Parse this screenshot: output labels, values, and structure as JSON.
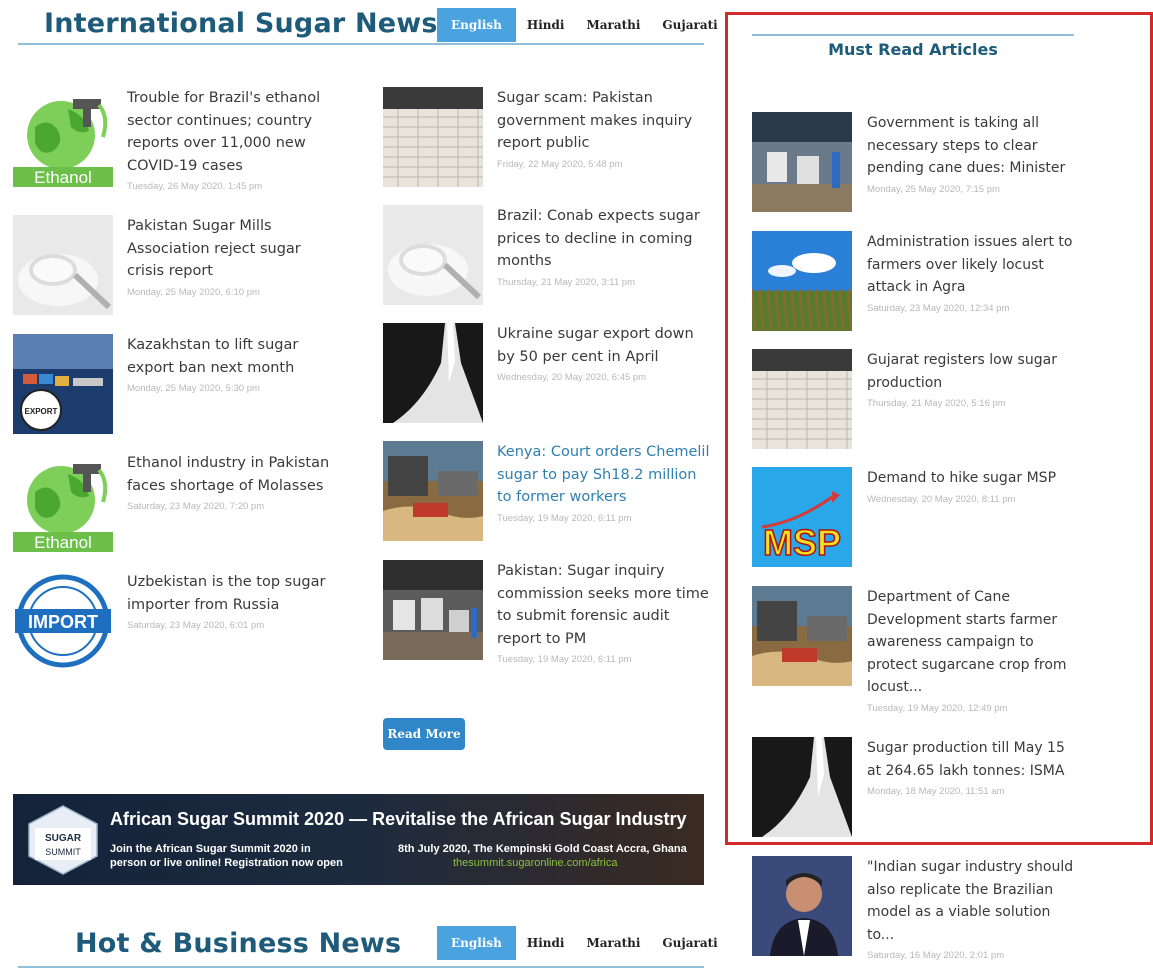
{
  "intl": {
    "title": "International Sugar News",
    "langs": [
      "English",
      "Hindi",
      "Marathi",
      "Gujarati"
    ],
    "left": [
      {
        "title": "Trouble for Brazil's ethanol sector continues; country reports over 11,000 new COVID-19 cases",
        "date": "Tuesday, 26 May 2020, 1:45 pm",
        "thumb": "ethanol"
      },
      {
        "title": "Pakistan Sugar Mills Association reject sugar crisis report",
        "date": "Monday, 25 May 2020, 6:10 pm",
        "thumb": "sugar-spoon"
      },
      {
        "title": "Kazakhstan to lift sugar export ban next month",
        "date": "Monday, 25 May 2020, 5:30 pm",
        "thumb": "export-port"
      },
      {
        "title": "Ethanol industry in Pakistan faces shortage of Molasses",
        "date": "Saturday, 23 May 2020, 7:20 pm",
        "thumb": "ethanol"
      },
      {
        "title": "Uzbekistan is the top sugar importer from Russia",
        "date": "Saturday, 23 May 2020, 6:01 pm",
        "thumb": "import-stamp"
      }
    ],
    "right": [
      {
        "title": "Sugar scam: Pakistan government makes inquiry report public",
        "date": "Friday, 22 May 2020, 5:48 pm",
        "thumb": "warehouse"
      },
      {
        "title": "Brazil: Conab expects sugar prices to decline in coming months",
        "date": "Thursday, 21 May 2020, 3:11 pm",
        "thumb": "sugar-spoon"
      },
      {
        "title": "Ukraine sugar export down by 50 per cent in April",
        "date": "Wednesday, 20 May 2020, 6:45 pm",
        "thumb": "sugar-pour"
      },
      {
        "title": "Kenya: Court orders Chemelil sugar to pay Sh18.2 million to former workers",
        "date": "Tuesday, 19 May 2020, 6:11 pm",
        "thumb": "factory-yard",
        "link": true
      },
      {
        "title": "Pakistan: Sugar inquiry commission seeks more time to submit forensic audit report to PM",
        "date": "Tuesday, 19 May 2020, 6:11 pm",
        "thumb": "mill-interior"
      }
    ],
    "read_more": "Read More"
  },
  "banner": {
    "logo_top": "SUGAR",
    "logo_bottom": "SUMMIT",
    "headline": "African Sugar Summit 2020 — Revitalise the African Sugar Industry",
    "line1": "Join the African Sugar Summit 2020 in",
    "line2": "person or live online! Registration now open",
    "right1": "8th July 2020, The Kempinski Gold Coast Accra, Ghana",
    "right2": "thesummit.sugaronline.com/africa"
  },
  "hot": {
    "title": "Hot & Business News",
    "langs": [
      "English",
      "Hindi",
      "Marathi",
      "Gujarati"
    ]
  },
  "sidebar": {
    "title": "Must Read Articles",
    "items": [
      {
        "title": "Government is taking all necessary steps to clear pending cane dues: Minister",
        "date": "Monday, 25 May 2020, 7:15 pm",
        "thumb": "warehouse-people"
      },
      {
        "title": "Administration issues alert to farmers over likely locust attack in Agra",
        "date": "Saturday, 23 May 2020, 12:34 pm",
        "thumb": "cane-field"
      },
      {
        "title": "Gujarat registers low sugar production",
        "date": "Thursday, 21 May 2020, 5:16 pm",
        "thumb": "warehouse"
      },
      {
        "title": "Demand to hike sugar MSP",
        "date": "Wednesday, 20 May 2020, 8:11 pm",
        "thumb": "msp",
        "thumb_text": "MSP"
      },
      {
        "title": "Department of Cane Development starts farmer awareness campaign to protect sugarcane crop from locust...",
        "date": "Tuesday, 19 May 2020, 12:49 pm",
        "thumb": "factory-yard"
      },
      {
        "title": "Sugar production till May 15 at 264.65 lakh tonnes: ISMA",
        "date": "Monday, 18 May 2020, 11:51 am",
        "thumb": "sugar-pour"
      },
      {
        "title": "\"Indian sugar industry should also replicate the Brazilian model as a viable solution to...",
        "date": "Saturday, 16 May 2020, 2:01 pm",
        "thumb": "portrait"
      }
    ]
  },
  "thumb_labels": {
    "ethanol": "Ethanol",
    "export": "EXPORT",
    "import": "IMPORT"
  }
}
